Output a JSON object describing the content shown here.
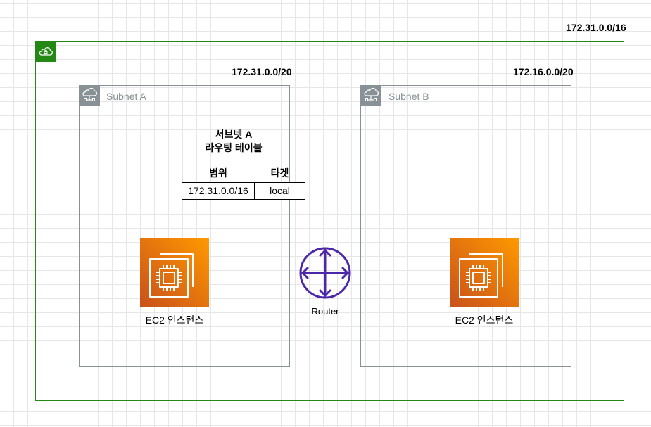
{
  "colors": {
    "vpc_border": "#248814",
    "subnet_border": "#879196",
    "ec2_gradient_start": "#c8511b",
    "ec2_gradient_end": "#ff9900",
    "router": "#4d27aa"
  },
  "vpc": {
    "cidr": "172.31.0.0/16",
    "icon": "vpc-cloud-lock-icon"
  },
  "subnets": [
    {
      "name": "Subnet A",
      "cidr": "172.31.0.0/20",
      "icon": "subnet-cloud-icon"
    },
    {
      "name": "Subnet B",
      "cidr": "172.16.0.0/20",
      "icon": "subnet-cloud-icon"
    }
  ],
  "route_table": {
    "title_line1": "서브넷 A",
    "title_line2": "라우팅 테이블",
    "columns": [
      "범위",
      "타겟"
    ],
    "rows": [
      [
        "172.31.0.0/16",
        "local"
      ]
    ]
  },
  "instances": [
    {
      "label": "EC2 인스턴스",
      "icon": "ec2-instance-icon"
    },
    {
      "label": "EC2 인스턴스",
      "icon": "ec2-instance-icon"
    }
  ],
  "router": {
    "label": "Router",
    "icon": "router-icon"
  }
}
